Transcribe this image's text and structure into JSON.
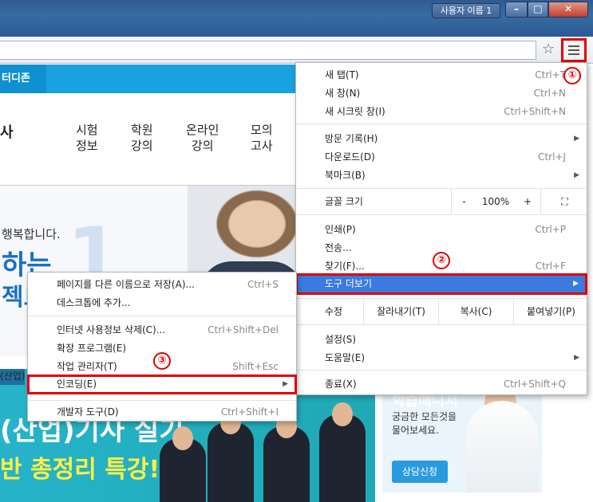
{
  "window": {
    "user_tab": "사용자 이름 1",
    "min_label": "–",
    "max_label": "□",
    "close_label": "✕"
  },
  "toolbar": {
    "star_icon": "star-icon",
    "star_glyph": "☆",
    "menu_icon": "hamburger-menu-icon"
  },
  "page": {
    "top_tab": "터디존",
    "nav": [
      {
        "line1": "시험",
        "line2": "정보"
      },
      {
        "line1": "학원",
        "line2": "강의"
      },
      {
        "line1": "온라인",
        "line2": "강의"
      },
      {
        "line1": "모의",
        "line2": "고사"
      }
    ],
    "left_glyph": "사",
    "hero_line1": "행복합니다.",
    "hero_line2": "하는",
    "hero_line3": "젝트",
    "hero_number": "1",
    "promo_tag": "(산업)",
    "promo_line1": "(산업)기사 실기",
    "promo_line2": "반 총정리 특강!",
    "side_title": "학습매니저",
    "side_text": "궁금한 모든것을 물어보세요.",
    "side_button": "상담신청"
  },
  "main_menu": {
    "items_top": [
      {
        "label": "새 탭(T)",
        "shortcut": "Ctrl+T"
      },
      {
        "label": "새 창(N)",
        "shortcut": "Ctrl+N"
      },
      {
        "label": "새 시크릿 창(I)",
        "shortcut": "Ctrl+Shift+N"
      }
    ],
    "items_history": [
      {
        "label": "방문 기록(H)",
        "shortcut": ""
      },
      {
        "label": "다운로드(D)",
        "shortcut": "Ctrl+J"
      },
      {
        "label": "북마크(B)",
        "shortcut": ""
      }
    ],
    "zoom": {
      "label": "글꼴 크기",
      "minus": "-",
      "value": "100%",
      "plus": "+",
      "fullscreen": "⛶"
    },
    "items_print": [
      {
        "label": "인쇄(P)",
        "shortcut": "Ctrl+P"
      },
      {
        "label": "전송...",
        "shortcut": ""
      },
      {
        "label": "찾기(F)...",
        "shortcut": "Ctrl+F"
      }
    ],
    "more_tools": "도구 더보기",
    "edit": {
      "label": "수정",
      "cut": "잘라내기(T)",
      "copy": "복사(C)",
      "paste": "붙여넣기(P)"
    },
    "items_settings": [
      {
        "label": "설정(S)",
        "shortcut": ""
      },
      {
        "label": "도움말(E)",
        "shortcut": ""
      }
    ],
    "exit": {
      "label": "종료(X)",
      "shortcut": "Ctrl+Shift+Q"
    }
  },
  "sub_menu": {
    "items_a": [
      {
        "label": "페이지를 다른 이름으로 저장(A)...",
        "shortcut": "Ctrl+S"
      },
      {
        "label": "데스크톱에 추가...",
        "shortcut": ""
      }
    ],
    "items_b": [
      {
        "label": "인터넷 사용정보 삭제(C)...",
        "shortcut": "Ctrl+Shift+Del"
      },
      {
        "label": "확장 프로그램(E)",
        "shortcut": ""
      },
      {
        "label": "작업 관리자(T)",
        "shortcut": "Shift+Esc"
      }
    ],
    "encoding": "인코딩(E)",
    "devtools": {
      "label": "개발자 도구(D)",
      "shortcut": "Ctrl+Shift+I"
    }
  },
  "callouts": [
    "①",
    "②",
    "③"
  ],
  "arrow_glyph": "▶"
}
